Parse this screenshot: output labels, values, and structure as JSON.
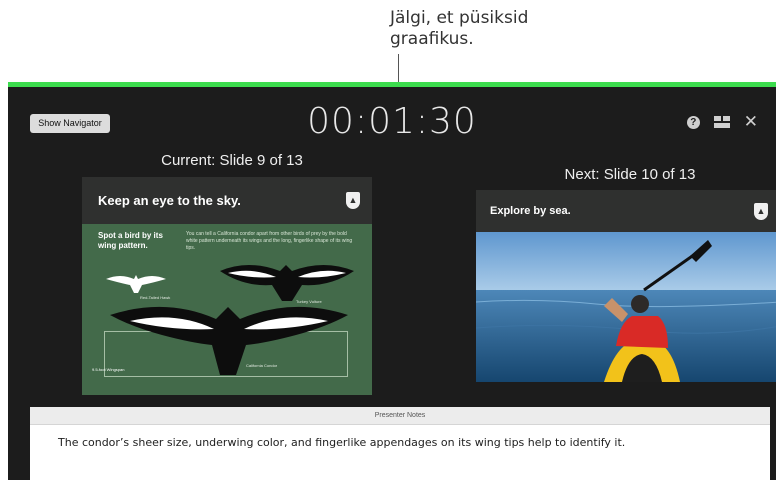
{
  "callout": {
    "text_line1": "Jälgi, et püsiksid",
    "text_line2": "graafikus."
  },
  "toolbar": {
    "show_navigator_label": "Show Navigator",
    "help_glyph": "?",
    "close_glyph": "✕"
  },
  "timer": {
    "value": "00:01:30"
  },
  "current": {
    "label": "Current: Slide 9 of 13",
    "slide": {
      "title": "Keep an eye to the sky.",
      "subtitle": "Spot a bird by its wing pattern.",
      "body": "You can tell a California condor apart from other birds of prey by the bold white pattern underneath its wings and the long, fingerlike shape of its wing tips.",
      "label_small": "Red-Tailed Hawk",
      "label_medium": "Turkey Vulture",
      "label_big": "California Condor",
      "footer": "9.5-foot Wingspan"
    }
  },
  "next": {
    "label": "Next: Slide 10 of 13",
    "slide": {
      "title": "Explore by sea."
    }
  },
  "notes": {
    "header": "Presenter Notes",
    "text": "The condor’s sheer size, underwing color, and fingerlike appendages on its wing tips help to identify it."
  },
  "colors": {
    "accent_green": "#3ddc4e",
    "stage_bg": "#1c1c1c",
    "slide_green": "#436a4a"
  }
}
